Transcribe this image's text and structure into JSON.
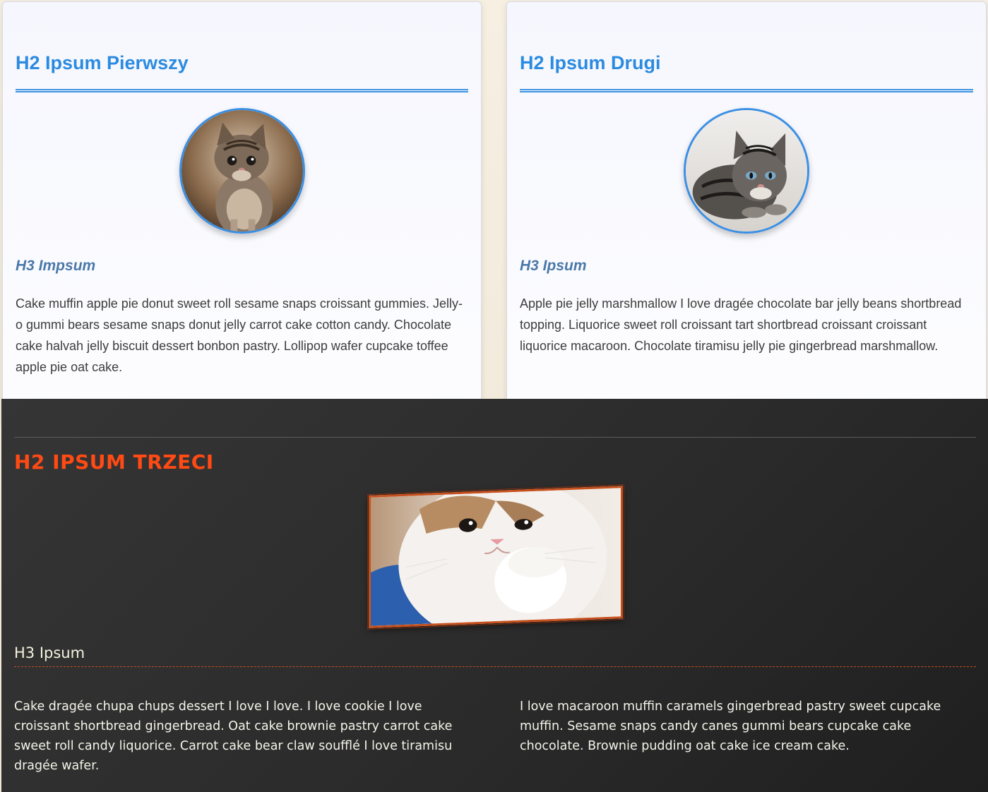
{
  "cards": [
    {
      "h2": "H2 Ipsum Pierwszy",
      "image_subject": "tabby kitten sitting",
      "h3": "H3 Impsum",
      "text": "Cake muffin apple pie donut sweet roll sesame snaps croissant gummies. Jelly-o gummi bears sesame snaps donut jelly carrot cake cotton candy. Chocolate cake halvah jelly biscuit dessert bonbon pastry. Lollipop wafer cupcake toffee apple pie oat cake."
    },
    {
      "h2": "H2 Ipsum Drugi",
      "image_subject": "grey tabby kitten lying",
      "h3": "H3 Ipsum",
      "text": "Apple pie jelly marshmallow I love dragée chocolate bar jelly beans shortbread topping. Liquorice sweet roll croissant tart shortbread croissant croissant liquorice macaroon. Chocolate tiramisu jelly pie gingerbread marshmallow."
    }
  ],
  "dark_section": {
    "h2": "H2 IPSUM TRZECI",
    "image_subject": "white cat with paw on chin",
    "h3": "H3 Ipsum",
    "columns": [
      "Cake dragée chupa chups dessert I love I love. I love cookie I love croissant shortbread gingerbread. Oat cake brownie pastry carrot cake sweet roll candy liquorice. Carrot cake bear claw soufflé I love tiramisu dragée wafer.",
      "I love macaroon muffin caramels gingerbread pastry sweet cupcake muffin. Sesame snaps candy canes gummi bears cupcake cake chocolate. Brownie pudding oat cake ice cream cake."
    ]
  },
  "colors": {
    "card_heading": "#2b8be0",
    "card_subheading": "#4a78a8",
    "dark_heading": "#ff4a14",
    "dark_background": "#2b2b2b"
  }
}
